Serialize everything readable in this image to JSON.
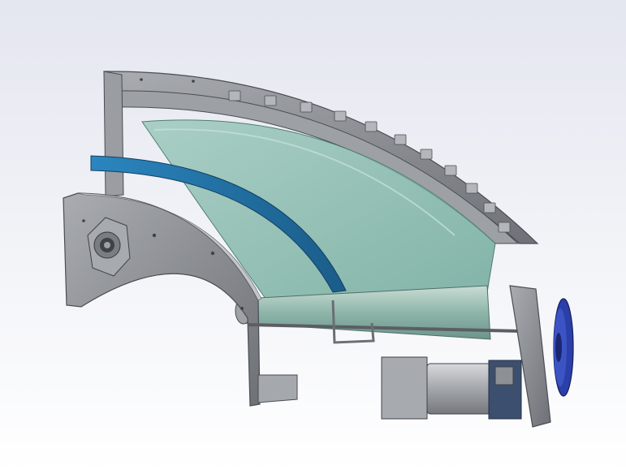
{
  "scene": {
    "subject": "curved-belt-conveyor-cad-model",
    "colors": {
      "background_top": "#e4e6f0",
      "background_bottom": "#ffffff",
      "frame_metal": "#8f9297",
      "frame_metal_light": "#b8bbbf",
      "frame_metal_dark": "#5d6066",
      "belt_glass": "#7fb7a8",
      "guide_rail_blue": "#1f6fa3",
      "pulley_blue": "#2a3fa8",
      "motor_gray": "#a3a6ab"
    },
    "icons": [
      "bearing-icon",
      "pulley-icon",
      "motor-icon"
    ]
  }
}
